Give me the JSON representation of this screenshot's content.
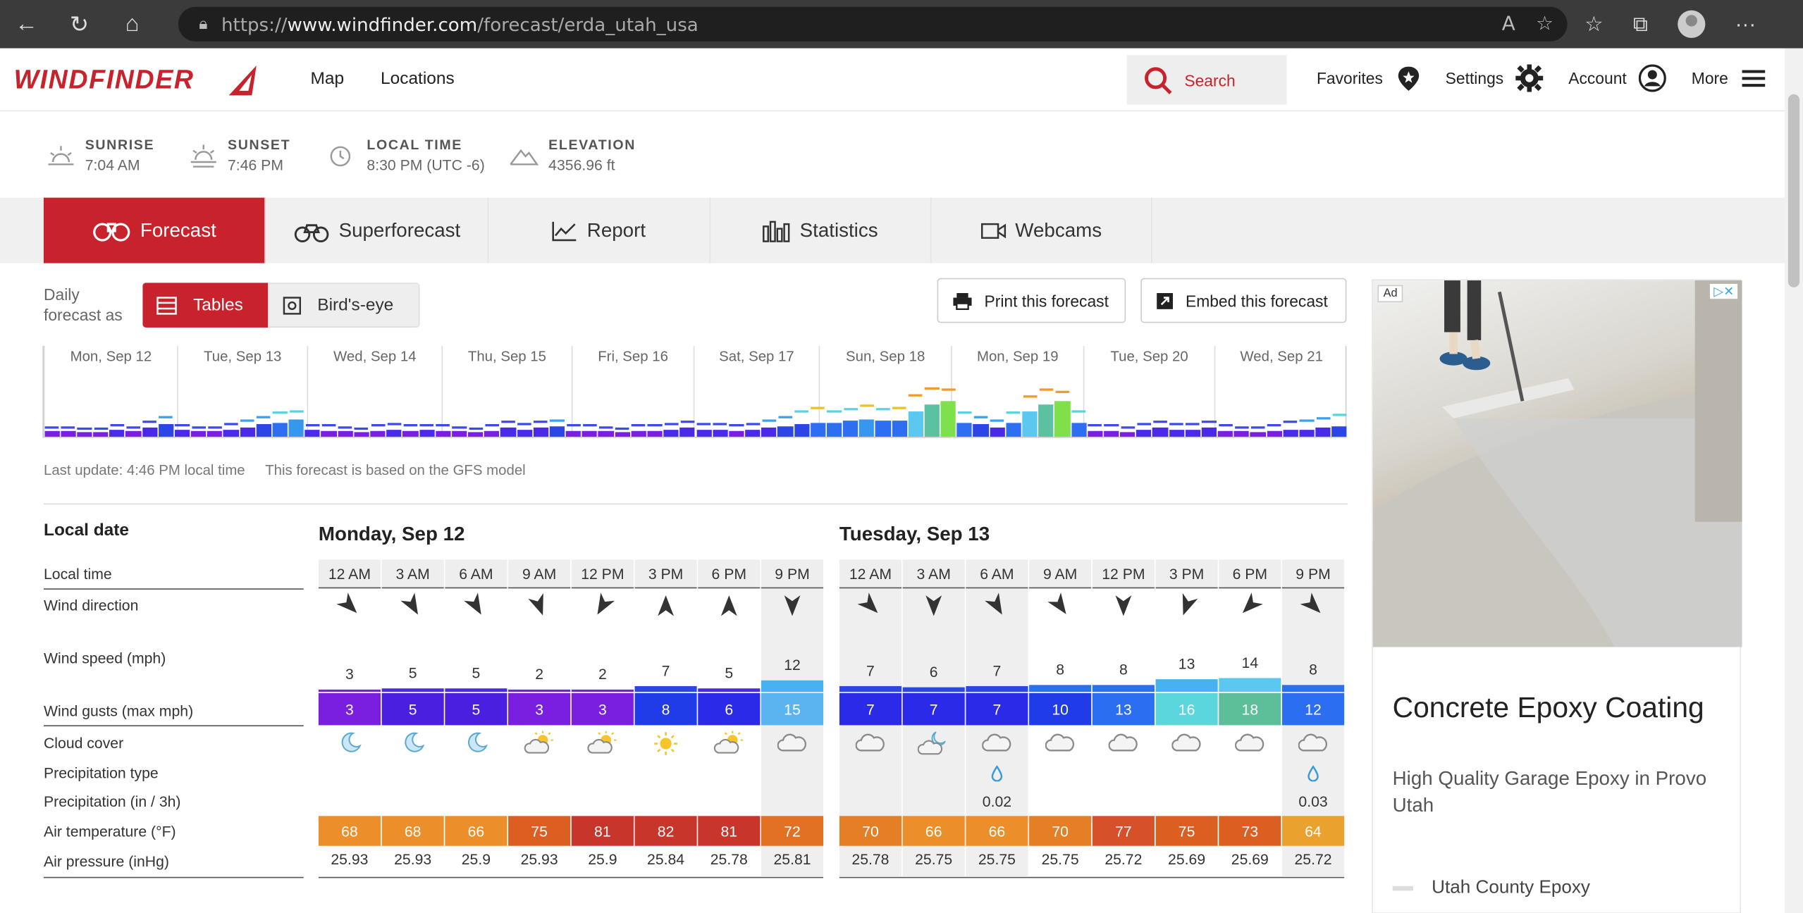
{
  "browser": {
    "url_prefix": "https://",
    "url_host": "www.windfinder.com",
    "url_path": "/forecast/erda_utah_usa"
  },
  "header": {
    "logo": "WINDFINDER",
    "nav": [
      "Map",
      "Locations"
    ],
    "search_label": "Search",
    "favorites": "Favorites",
    "settings": "Settings",
    "account": "Account",
    "more": "More"
  },
  "info": {
    "sunrise_label": "SUNRISE",
    "sunrise": "7:04 AM",
    "sunset_label": "SUNSET",
    "sunset": "7:46 PM",
    "localtime_label": "LOCAL TIME",
    "localtime": "8:30 PM (UTC -6)",
    "elevation_label": "ELEVATION",
    "elevation": "4356.96 ft"
  },
  "tabs": [
    "Forecast",
    "Superforecast",
    "Report",
    "Statistics",
    "Webcams"
  ],
  "controls": {
    "daily_label_1": "Daily",
    "daily_label_2": "forecast as",
    "tables": "Tables",
    "birdseye": "Bird's-eye",
    "print": "Print this forecast",
    "embed": "Embed this forecast"
  },
  "overview": {
    "days": [
      "Mon, Sep 12",
      "Tue, Sep 13",
      "Wed, Sep 14",
      "Thu, Sep 15",
      "Fri, Sep 16",
      "Sat, Sep 17",
      "Sun, Sep 18",
      "Mon, Sep 19",
      "Tue, Sep 20",
      "Wed, Sep 21"
    ],
    "speeds": [
      3,
      3,
      2,
      2,
      4,
      3,
      5,
      7,
      4,
      3,
      3,
      4,
      5,
      7,
      8,
      10,
      4,
      3,
      3,
      2,
      3,
      4,
      3,
      4,
      3,
      3,
      2,
      3,
      5,
      4,
      5,
      6,
      3,
      3,
      3,
      2,
      3,
      3,
      4,
      5,
      4,
      4,
      3,
      4,
      5,
      6,
      7,
      8,
      8,
      9,
      10,
      9,
      9,
      14,
      18,
      20,
      8,
      7,
      5,
      8,
      14,
      18,
      20,
      8,
      3,
      3,
      2,
      4,
      5,
      4,
      4,
      5,
      3,
      3,
      2,
      3,
      4,
      4,
      5,
      6
    ],
    "gusts": [
      4,
      4,
      3,
      3,
      5,
      4,
      7,
      10,
      5,
      4,
      4,
      6,
      8,
      10,
      12,
      13,
      5,
      5,
      4,
      3,
      5,
      6,
      5,
      5,
      5,
      4,
      3,
      5,
      7,
      6,
      7,
      8,
      5,
      5,
      4,
      3,
      5,
      5,
      6,
      7,
      6,
      6,
      5,
      6,
      8,
      10,
      13,
      15,
      13,
      14,
      16,
      14,
      15,
      22,
      26,
      25,
      12,
      10,
      8,
      12,
      21,
      25,
      24,
      13,
      5,
      5,
      4,
      6,
      7,
      6,
      6,
      7,
      5,
      4,
      4,
      5,
      7,
      8,
      9,
      11
    ]
  },
  "meta": {
    "last_update": "Last update: 4:46 PM local time",
    "model": "This forecast is based on the GFS model"
  },
  "table": {
    "labels": {
      "local_date": "Local date",
      "local_time": "Local time",
      "wind_direction": "Wind direction",
      "wind_speed": "Wind speed (mph)",
      "wind_gusts": "Wind gusts (max mph)",
      "cloud_cover": "Cloud cover",
      "precip_type": "Precipitation type",
      "precip": "Precipitation (in / 3h)",
      "air_temp": "Air temperature (°F)",
      "air_pressure": "Air pressure (inHg)"
    },
    "days": [
      {
        "title": "Monday, Sep 12",
        "times": [
          "12 AM",
          "3 AM",
          "6 AM",
          "9 AM",
          "12 PM",
          "3 PM",
          "6 PM",
          "9 PM"
        ],
        "dir_deg": [
          135,
          150,
          150,
          160,
          210,
          0,
          0,
          180
        ],
        "speed": [
          3,
          5,
          5,
          2,
          2,
          7,
          5,
          12
        ],
        "gust": [
          3,
          5,
          5,
          3,
          3,
          8,
          6,
          15
        ],
        "cloud": [
          "moon",
          "moon",
          "moon",
          "partly",
          "partly",
          "sun",
          "partly",
          "cloud"
        ],
        "precip_type": [
          "",
          "",
          "",
          "",
          "",
          "",
          "",
          ""
        ],
        "precip": [
          "",
          "",
          "",
          "",
          "",
          "",
          "",
          ""
        ],
        "temp": [
          68,
          68,
          66,
          75,
          81,
          82,
          81,
          72
        ],
        "pressure": [
          "25.93",
          "25.93",
          "25.9",
          "25.93",
          "25.9",
          "25.84",
          "25.78",
          "25.81"
        ]
      },
      {
        "title": "Tuesday, Sep 13",
        "times": [
          "12 AM",
          "3 AM",
          "6 AM",
          "9 AM",
          "12 PM",
          "3 PM",
          "6 PM",
          "9 PM"
        ],
        "dir_deg": [
          135,
          180,
          150,
          145,
          180,
          200,
          225,
          135
        ],
        "speed": [
          7,
          6,
          7,
          8,
          8,
          13,
          14,
          8
        ],
        "gust": [
          7,
          7,
          7,
          10,
          13,
          16,
          18,
          12
        ],
        "cloud": [
          "cloud",
          "mooncloud",
          "cloud",
          "cloud",
          "cloud",
          "cloud",
          "cloud",
          "cloud"
        ],
        "precip_type": [
          "",
          "",
          "rain",
          "",
          "",
          "",
          "",
          "rain"
        ],
        "precip": [
          "",
          "",
          "0.02",
          "",
          "",
          "",
          "",
          "0.03"
        ],
        "temp": [
          70,
          66,
          66,
          70,
          77,
          75,
          73,
          64
        ],
        "pressure": [
          "25.78",
          "25.75",
          "25.75",
          "25.75",
          "25.72",
          "25.69",
          "25.69",
          "25.72"
        ]
      }
    ]
  },
  "ad": {
    "badge": "Ad",
    "title": "Concrete Epoxy Coating",
    "subtitle": "High Quality Garage Epoxy in Provo Utah",
    "brand": "Utah County Epoxy"
  },
  "colors": {
    "brand_red": "#c8232c",
    "tab_bg": "#f0f0f0"
  }
}
